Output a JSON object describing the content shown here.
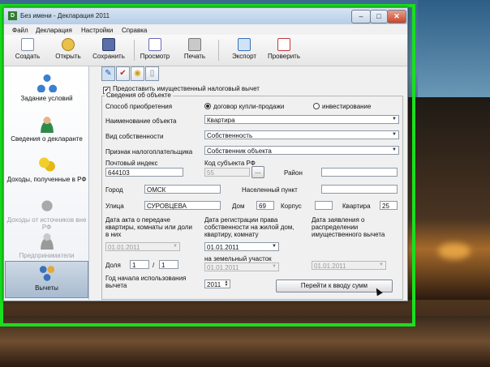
{
  "window": {
    "title": "Без имени - Декларация 2011",
    "icon_text": "D",
    "min_glyph": "–",
    "max_glyph": "□",
    "close_glyph": "✕"
  },
  "menu": [
    "Файл",
    "Декларация",
    "Настройки",
    "Справка"
  ],
  "toolbar": [
    "Создать",
    "Открыть",
    "Сохранить",
    "Просмотр",
    "Печать",
    "Экспорт",
    "Проверить"
  ],
  "sidebar": [
    {
      "label": "Задание условий",
      "icon": "network-icon"
    },
    {
      "label": "Сведения о декларанте",
      "icon": "person-icon"
    },
    {
      "label": "Доходы, полученные в РФ",
      "icon": "coins-icon"
    },
    {
      "label": "Доходы от источников вне РФ",
      "icon": "money-bag-icon"
    },
    {
      "label": "Предприниматели",
      "icon": "businessman-icon"
    },
    {
      "label": "Вычеты",
      "icon": "people-group-icon"
    }
  ],
  "tabs": {
    "icons": [
      "document-edit-icon",
      "red-check-icon",
      "coins-icon",
      "blank-page-icon"
    ],
    "glyphs": [
      "✎",
      "✔",
      "◉",
      "▯"
    ]
  },
  "form": {
    "checkbox_label": "Предоставить имущественный налоговый вычет",
    "checkbox_glyph": "✔",
    "group_title": "Сведения об объекте",
    "method_label": "Способ приобретения",
    "radio_sale": "договор купли-продажи",
    "radio_invest": "инвестирование",
    "object_name_label": "Наименование объекта",
    "object_name_value": "Квартира",
    "ownership_label": "Вид собственности",
    "ownership_value": "Собственность",
    "taxpayer_label": "Признак налогоплательщика",
    "taxpayer_value": "Собственник объекта",
    "postal_label": "Почтовый индекс",
    "postal_value": "644103",
    "region_label": "Код субъекта РФ",
    "region_value": "55",
    "region_btn": "...",
    "district_label": "Район",
    "city_label": "Город",
    "city_value": "ОМСК",
    "settlement_label": "Населенный пункт",
    "street_label": "Улица",
    "street_value": "СУРОВЦЕВА",
    "house_label": "Дом",
    "house_value": "69",
    "building_label": "Корпус",
    "apartment_label": "Квартира",
    "apartment_value": "25",
    "transfer_date_label": "Дата акта о передаче квартиры, комнаты или доли в них",
    "transfer_date_value": "01.01.2011",
    "reg_date_label": "Дата регистрации права собственности на жилой дом, квартиру, комнату",
    "reg_date_value": "01.01.2011",
    "land_label": "на земельный участок",
    "land_value": "01.01.2011",
    "distribution_label": "Дата заявления о распределении имущественного вычета",
    "distribution_value": "01.01.2011",
    "share_label": "Доля",
    "share_num": "1",
    "share_slash": "/",
    "share_den": "1",
    "year_label": "Год начала использования вычета",
    "year_value": "2011",
    "goto_button": "Перейти к вводу сумм",
    "dd_glyph": "▼",
    "spin_up": "▲",
    "spin_down": "▼"
  }
}
